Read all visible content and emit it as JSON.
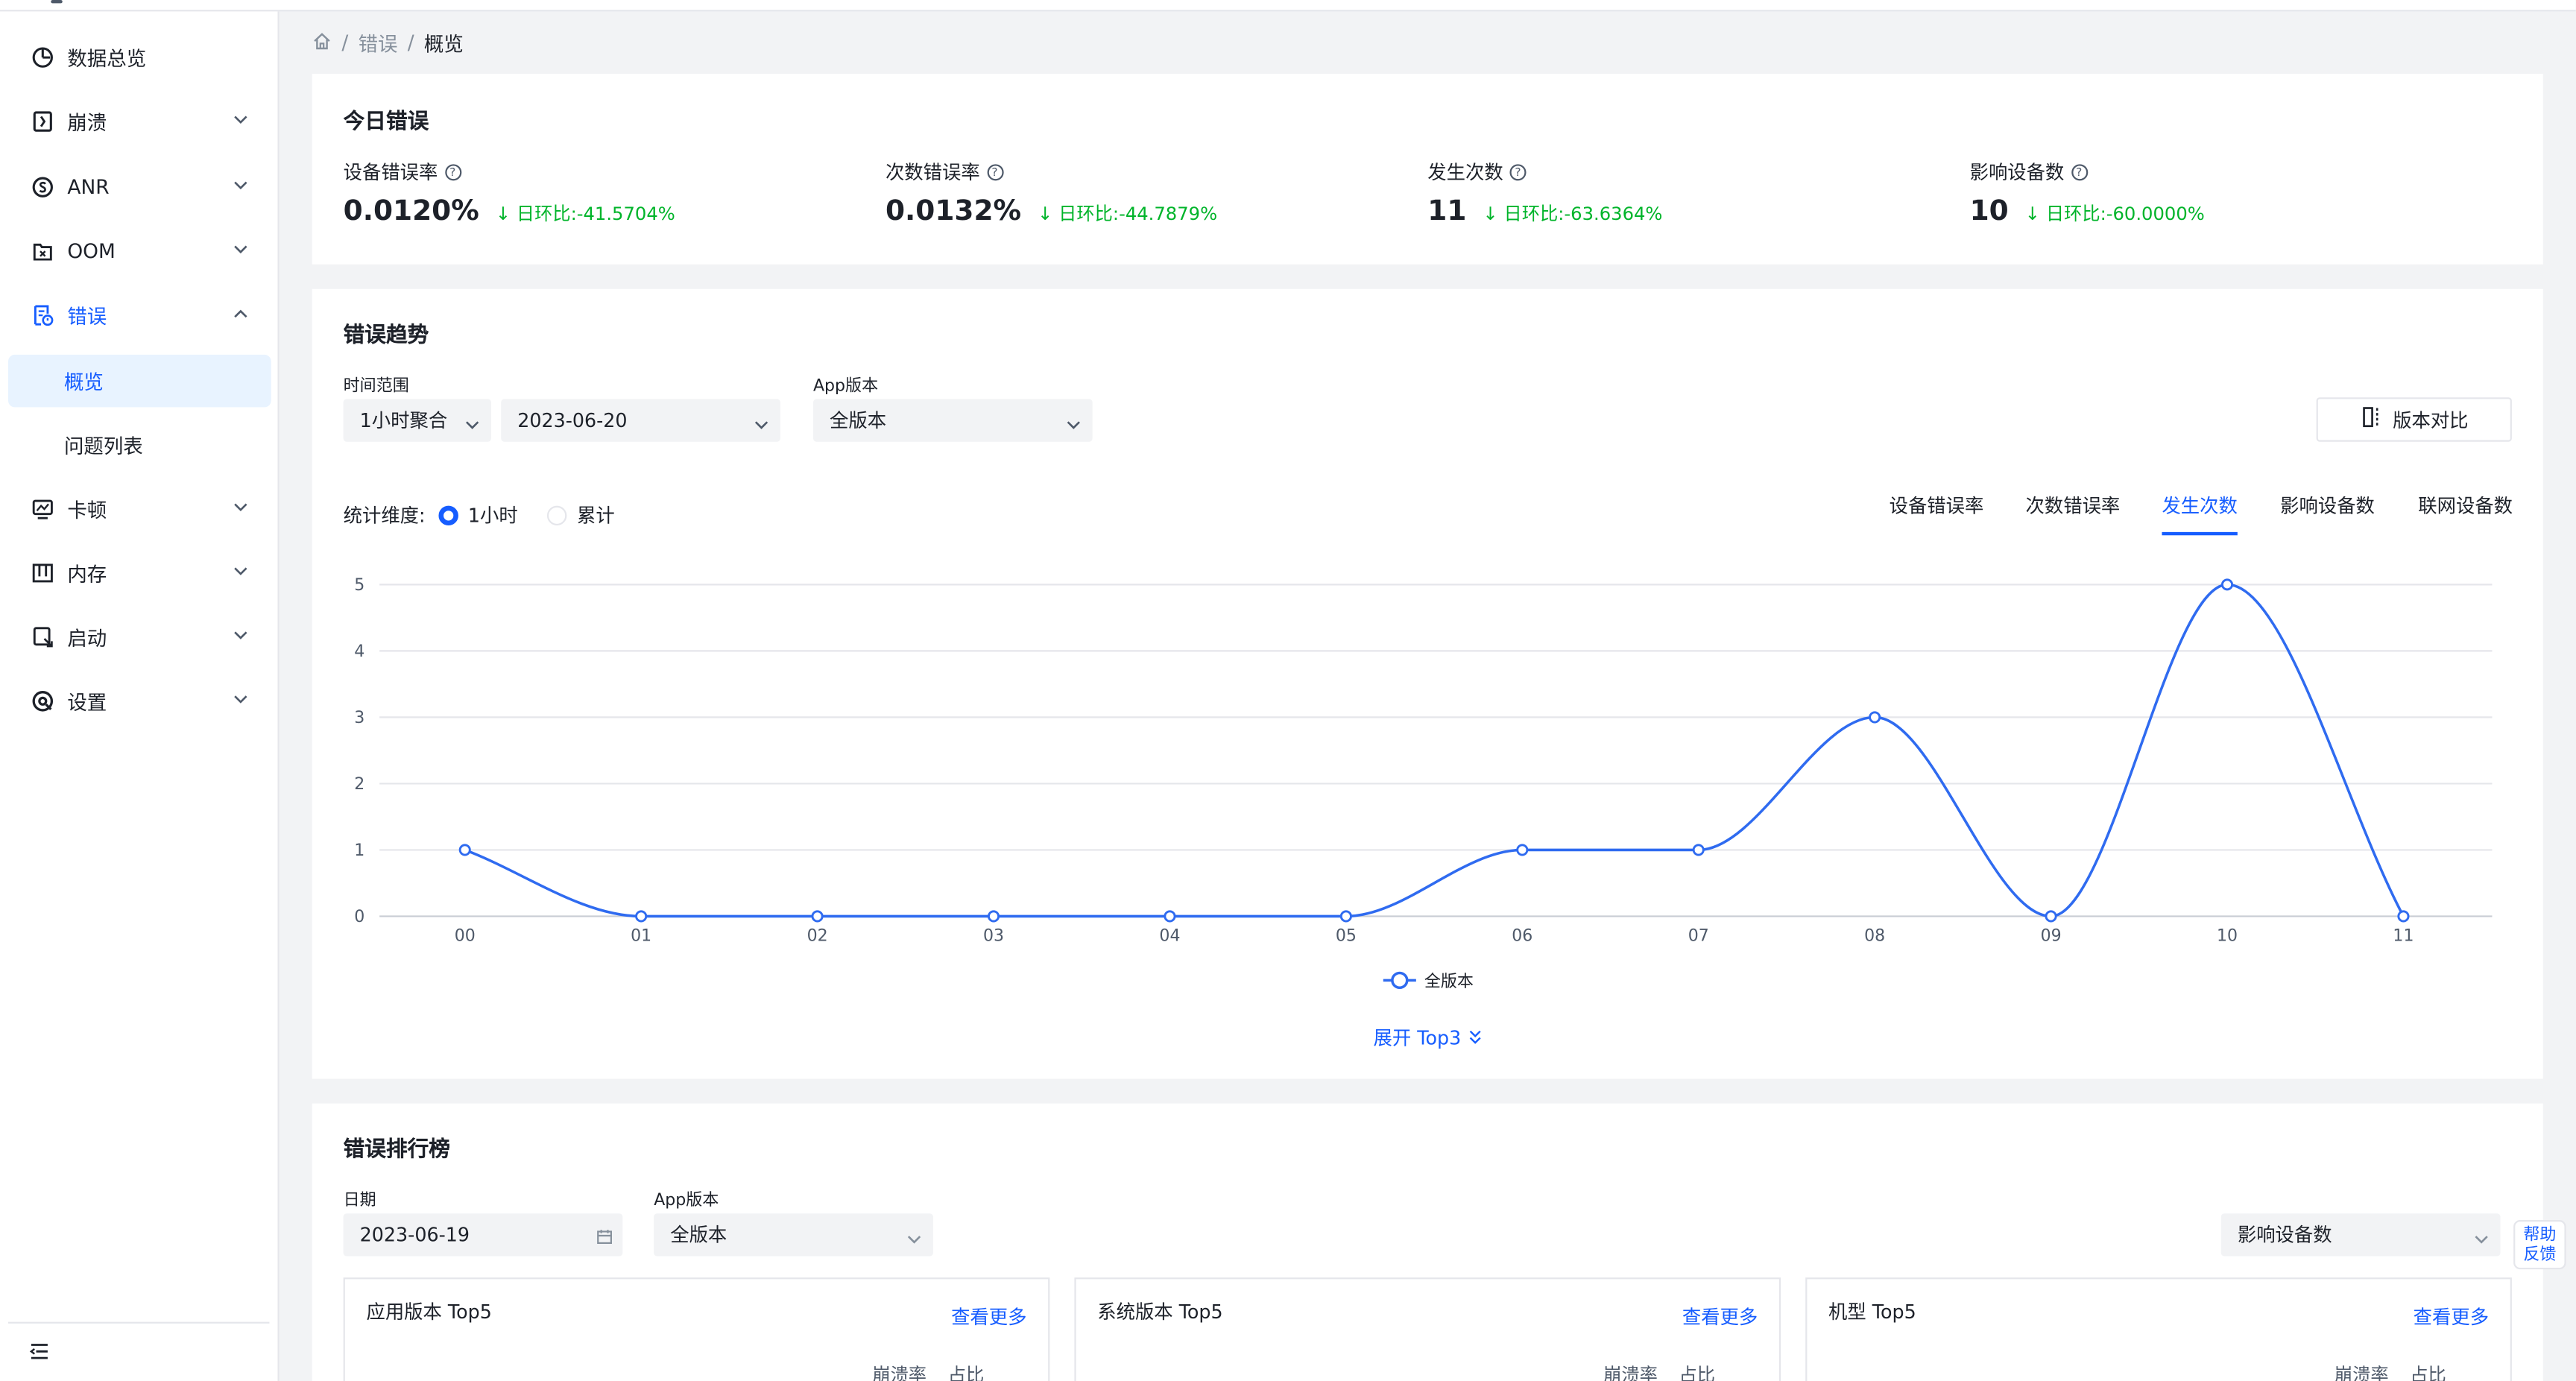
{
  "sidebar": {
    "items": [
      {
        "label": "数据总览",
        "icon": "pie-chart-icon"
      },
      {
        "label": "崩溃",
        "icon": "crash-file-icon"
      },
      {
        "label": "ANR",
        "icon": "anr-dollar-icon"
      },
      {
        "label": "OOM",
        "icon": "oom-file-icon"
      },
      {
        "label": "错误",
        "icon": "error-file-icon"
      },
      {
        "label": "卡顿",
        "icon": "lag-monitor-icon"
      },
      {
        "label": "内存",
        "icon": "memory-bars-icon"
      },
      {
        "label": "启动",
        "icon": "launch-icon"
      },
      {
        "label": "设置",
        "icon": "settings-icon"
      }
    ],
    "sub_items": [
      "概览",
      "问题列表"
    ]
  },
  "breadcrumb": {
    "items": [
      "错误",
      "概览"
    ]
  },
  "today": {
    "title": "今日错误",
    "stats": [
      {
        "label": "设备错误率",
        "value": "0.0120%",
        "change": "日环比:-41.5704%"
      },
      {
        "label": "次数错误率",
        "value": "0.0132%",
        "change": "日环比:-44.7879%"
      },
      {
        "label": "发生次数",
        "value": "11",
        "change": "日环比:-63.6364%"
      },
      {
        "label": "影响设备数",
        "value": "10",
        "change": "日环比:-60.0000%"
      }
    ]
  },
  "trend": {
    "title": "错误趋势",
    "time_range_label": "时间范围",
    "aggregation": "1小时聚合",
    "date": "2023-06-20",
    "app_version_label": "App版本",
    "app_version": "全版本",
    "compare_button": "版本对比",
    "dimension_label": "统计维度:",
    "dimension_options": [
      "1小时",
      "累计"
    ],
    "tabs": [
      "设备错误率",
      "次数错误率",
      "发生次数",
      "影响设备数",
      "联网设备数"
    ],
    "expand_label": "展开 Top3"
  },
  "chart_data": {
    "type": "line",
    "x": [
      "00",
      "01",
      "02",
      "03",
      "04",
      "05",
      "06",
      "07",
      "08",
      "09",
      "10",
      "11"
    ],
    "series": [
      {
        "name": "全版本",
        "values": [
          1,
          0,
          0,
          0,
          0,
          0,
          1,
          1,
          3,
          0,
          5,
          0
        ],
        "color": "#2f6bf0"
      }
    ],
    "yticks": [
      0,
      1,
      2,
      3,
      4,
      5
    ],
    "ylim": [
      0,
      5
    ],
    "grid": true,
    "smooth": true,
    "legend": "bottom-center"
  },
  "ranking": {
    "title": "错误排行榜",
    "date_label": "日期",
    "date": "2023-06-19",
    "app_version_label": "App版本",
    "app_version": "全版本",
    "metric": "影响设备数",
    "cards": [
      {
        "title": "应用版本 Top5",
        "more": "查看更多",
        "col1": "崩溃率",
        "col2": "占比"
      },
      {
        "title": "系统版本 Top5",
        "more": "查看更多",
        "col1": "崩溃率",
        "col2": "占比"
      },
      {
        "title": "机型 Top5",
        "more": "查看更多",
        "col1": "崩溃率",
        "col2": "占比"
      }
    ]
  },
  "help": {
    "line1": "帮助",
    "line2": "反馈"
  },
  "colors": {
    "accent": "#165dff",
    "positive": "#00b42a",
    "line": "#2f6bf0"
  }
}
